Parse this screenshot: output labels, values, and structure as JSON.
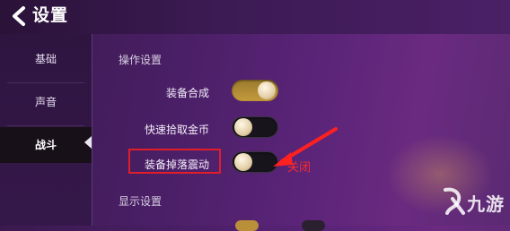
{
  "header": {
    "title": "设置",
    "back_icon": "chevron-left-icon"
  },
  "sidebar": {
    "items": [
      {
        "label": "基础",
        "active": false
      },
      {
        "label": "声音",
        "active": false
      },
      {
        "label": "战斗",
        "active": true
      }
    ]
  },
  "sections": {
    "operation": {
      "title": "操作设置",
      "settings": [
        {
          "label": "装备合成",
          "state": "on"
        },
        {
          "label": "快速拾取金币",
          "state": "off"
        },
        {
          "label": "装备掉落震动",
          "state": "off"
        }
      ]
    },
    "display": {
      "title": "显示设置"
    }
  },
  "annotation": {
    "text": "关闭",
    "color": "#ff2a2a"
  },
  "watermark": {
    "text": "九游",
    "icon": "jiuyou-logo-icon"
  },
  "colors": {
    "accent": "#c49a3c",
    "highlight": "#e01e2a"
  }
}
